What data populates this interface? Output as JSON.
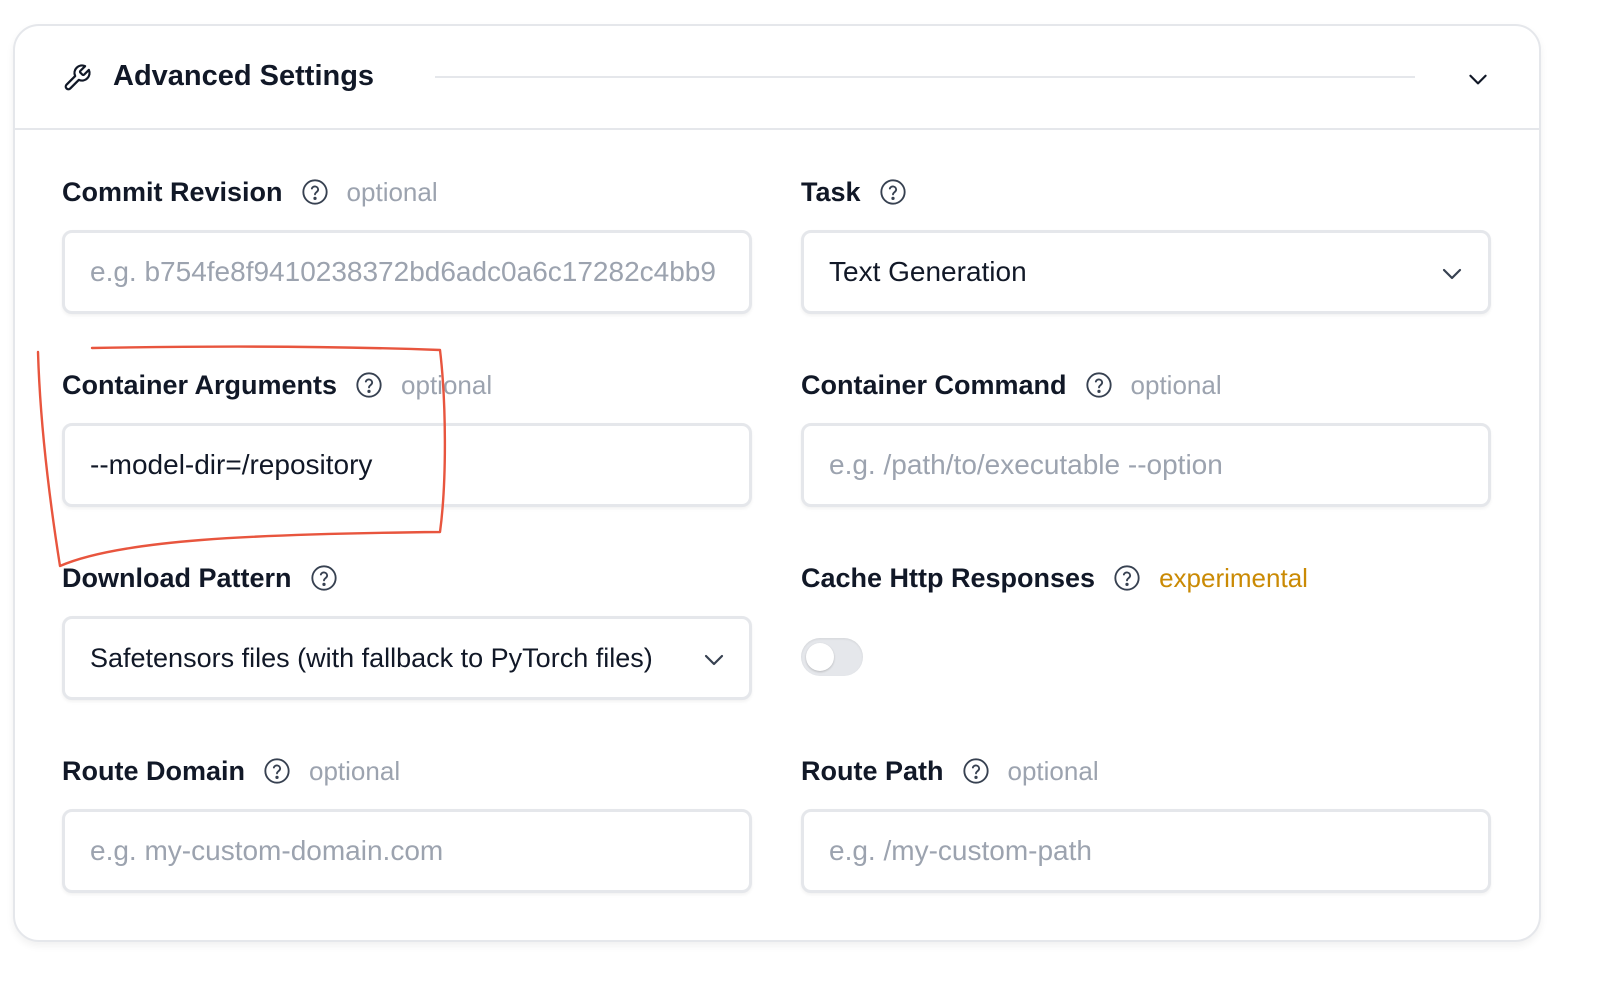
{
  "header": {
    "title": "Advanced Settings",
    "icon": "wrench-icon"
  },
  "fields": {
    "commit_revision": {
      "label": "Commit Revision",
      "tag": "optional",
      "placeholder": "e.g. b754fe8f9410238372bd6adc0a6c17282c4bb9"
    },
    "task": {
      "label": "Task",
      "value": "Text Generation"
    },
    "container_arguments": {
      "label": "Container Arguments",
      "tag": "optional",
      "value": "--model-dir=/repository"
    },
    "container_command": {
      "label": "Container Command",
      "tag": "optional",
      "placeholder": "e.g. /path/to/executable --option"
    },
    "download_pattern": {
      "label": "Download Pattern",
      "value": "Safetensors files (with fallback to PyTorch files)"
    },
    "cache_http_responses": {
      "label": "Cache Http Responses",
      "tag": "experimental",
      "enabled": false
    },
    "route_domain": {
      "label": "Route Domain",
      "tag": "optional",
      "placeholder": "e.g. my-custom-domain.com"
    },
    "route_path": {
      "label": "Route Path",
      "tag": "optional",
      "placeholder": "e.g. /my-custom-path"
    }
  },
  "colors": {
    "annotation": "#e8553e",
    "experimental": "#ca8a04",
    "muted": "#9ca3af"
  }
}
